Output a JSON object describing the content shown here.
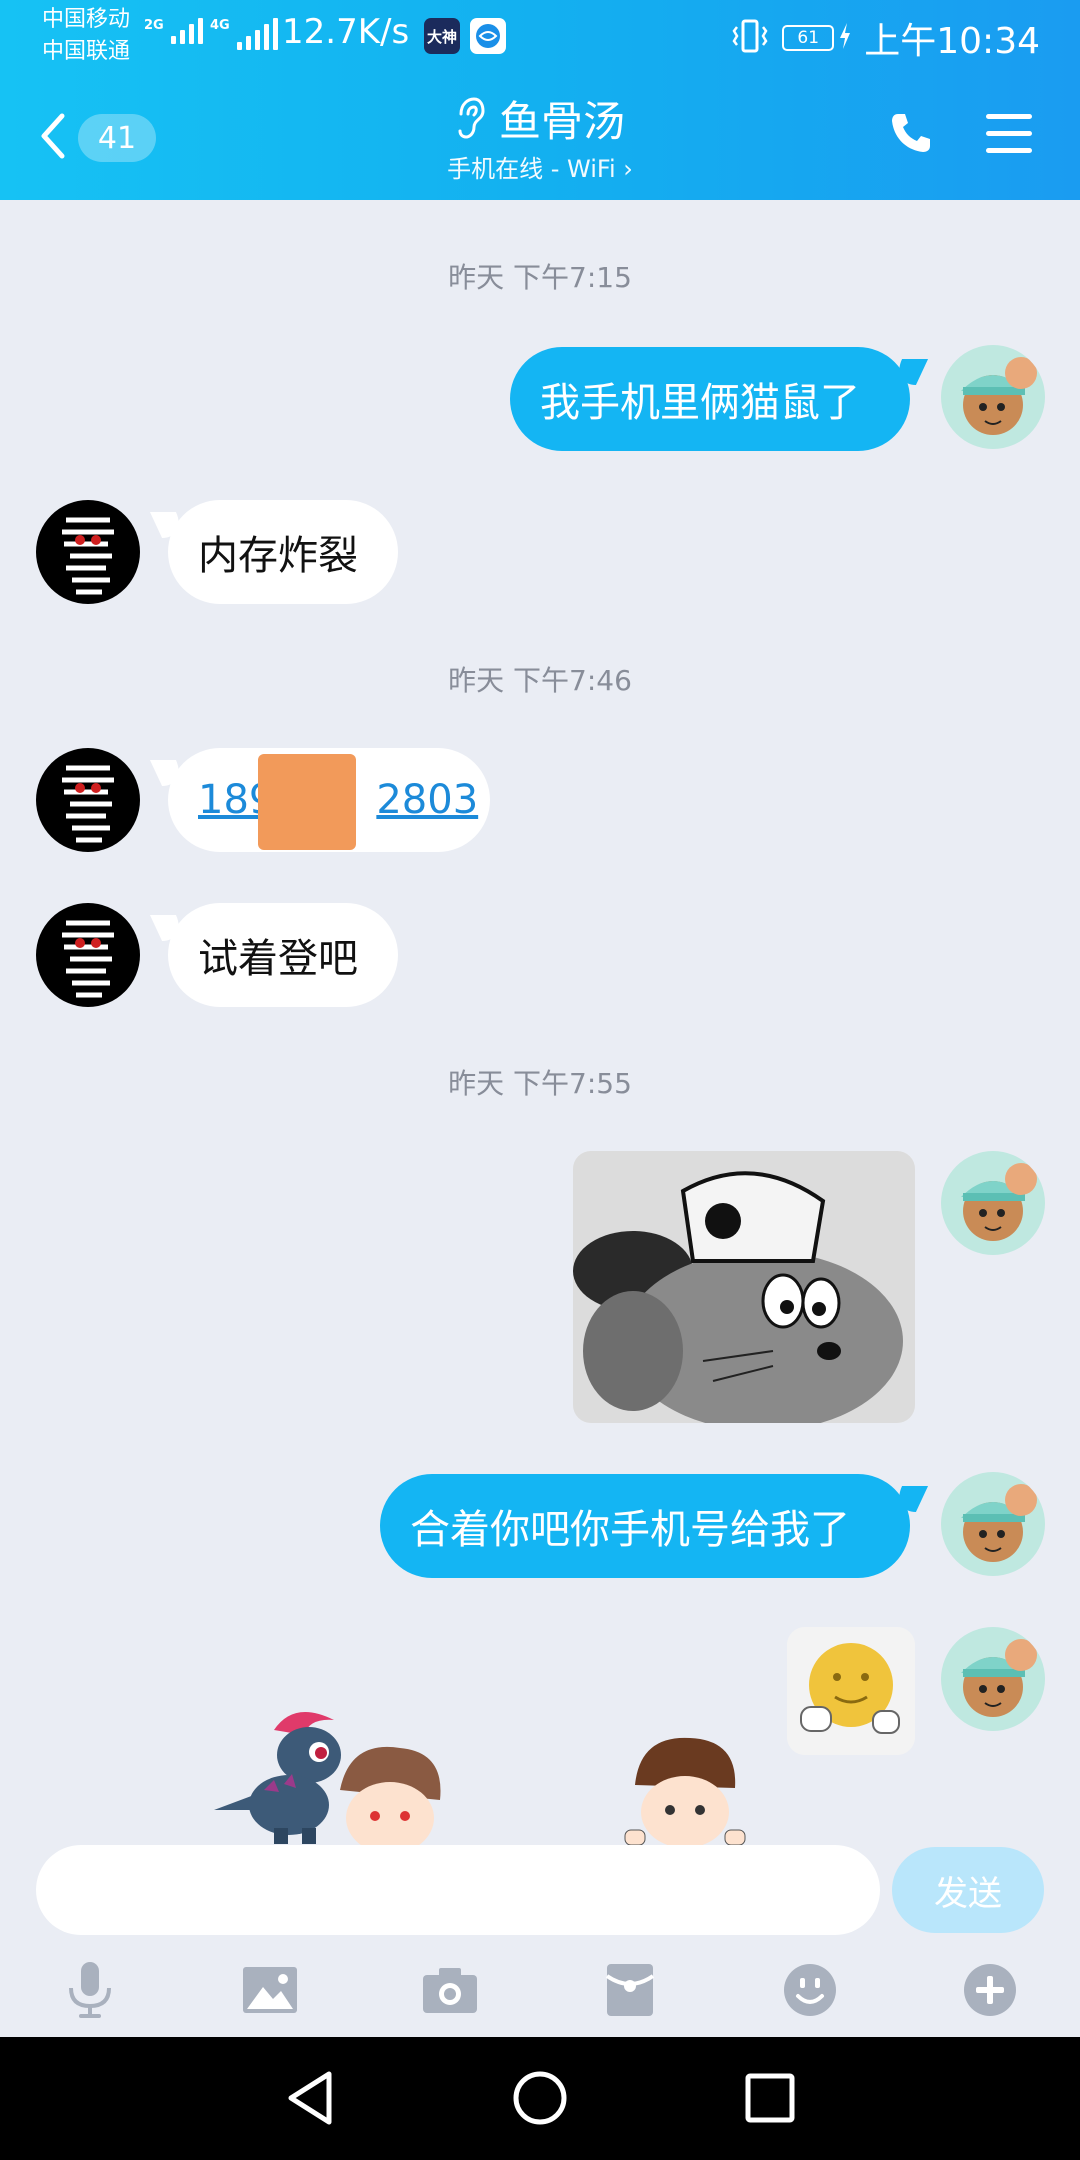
{
  "status_bar": {
    "carrier_1": "中国移动",
    "carrier_2": "中国联通",
    "net_1": "2G",
    "net_2": "4G",
    "speed": "12.7K/s",
    "app_badge_1": "大神",
    "battery": "61",
    "time": "上午10:34"
  },
  "header": {
    "unread_count": "41",
    "title": "鱼骨汤",
    "subtitle": "手机在线 - WiFi ›"
  },
  "messages": {
    "ts_1": "昨天 下午7:15",
    "out_1": "我手机里俩猫鼠了",
    "in_1": "内存炸裂",
    "ts_2": "昨天 下午7:46",
    "in_2_left": "189",
    "in_2_right": "2803",
    "in_3": "试着登吧",
    "ts_3": "昨天 下午7:55",
    "out_3": "合着你吧你手机号给我了"
  },
  "input": {
    "value": "",
    "send_label": "发送"
  },
  "colors": {
    "header_start": "#16c2f4",
    "header_end": "#1a9cf1",
    "outgoing_bubble": "#14b5f3",
    "incoming_bubble": "#ffffff",
    "send_button": "#b9e6fb",
    "chat_background": "#eaedf4"
  },
  "icons": {
    "back": "chevron-left-icon",
    "hearing": "ear-icon",
    "call": "phone-icon",
    "menu": "menu-icon",
    "voice": "microphone-icon",
    "photo": "image-icon",
    "camera": "camera-icon",
    "red_packet": "red-packet-icon",
    "emoji": "emoji-icon",
    "more": "plus-icon"
  }
}
